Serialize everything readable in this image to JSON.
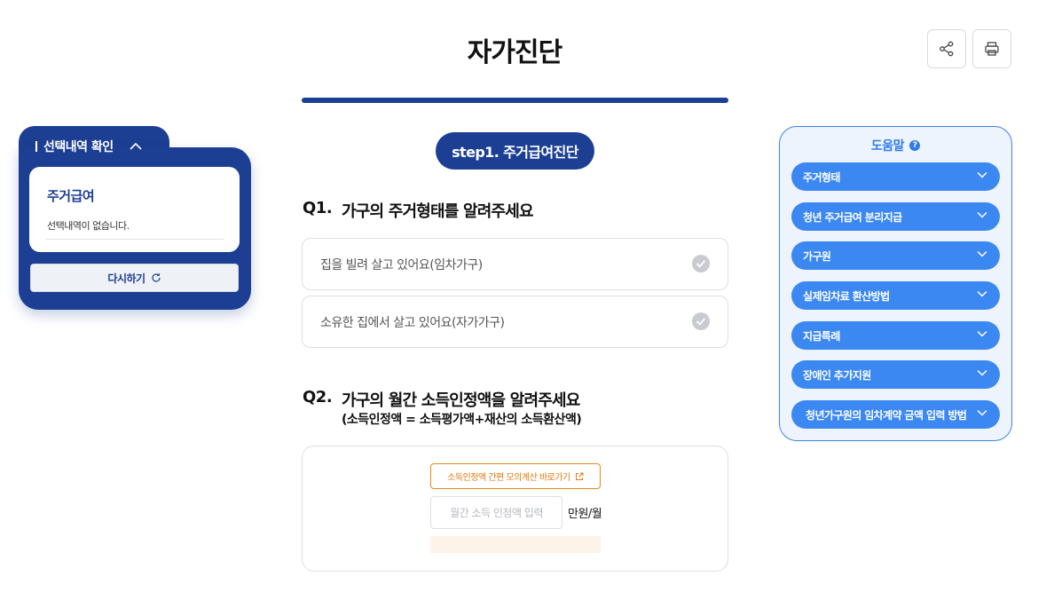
{
  "page": {
    "title": "자가진단"
  },
  "toolbar": {
    "share_icon": "share-icon",
    "print_icon": "print-icon"
  },
  "selection_panel": {
    "header": "선택내역 확인",
    "card_title": "주거급여",
    "card_message": "선택내역이 없습니다.",
    "retry_label": "다시하기",
    "retry_icon": "refresh-icon",
    "toggle_icon": "chevron-up-icon"
  },
  "step": {
    "label": "step1. 주거급여진단"
  },
  "q1": {
    "number": "Q1.",
    "text": "가구의 주거형태를 알려주세요",
    "options": [
      {
        "label": "집을 빌려 살고 있어요(임차가구)"
      },
      {
        "label": "소유한 집에서 살고 있어요(자가가구)"
      }
    ]
  },
  "q2": {
    "number": "Q2.",
    "text": "가구의 월간 소득인정액을 알려주세요",
    "sub": "(소득인정액 = 소득평가액+재산의 소득환산액)",
    "calc_link": "소득인정액 간편 모의계산 바로가기",
    "input_placeholder": "월간 소득 인정액 입력",
    "input_value": "",
    "unit": "만원/월"
  },
  "help": {
    "title": "도움말",
    "items": [
      {
        "label": "주거형태"
      },
      {
        "label": "청년 주거급여 분리지급"
      },
      {
        "label": "가구원"
      },
      {
        "label": "실제임차료 환산방법"
      },
      {
        "label": "지급특례"
      },
      {
        "label": "장애인 추가지원"
      },
      {
        "label": "청년가구원의 임차계약 금액 입력 방법"
      }
    ]
  },
  "colors": {
    "primary": "#1d3f93",
    "help_blue": "#3c88f2",
    "link_orange": "#e07a10"
  }
}
